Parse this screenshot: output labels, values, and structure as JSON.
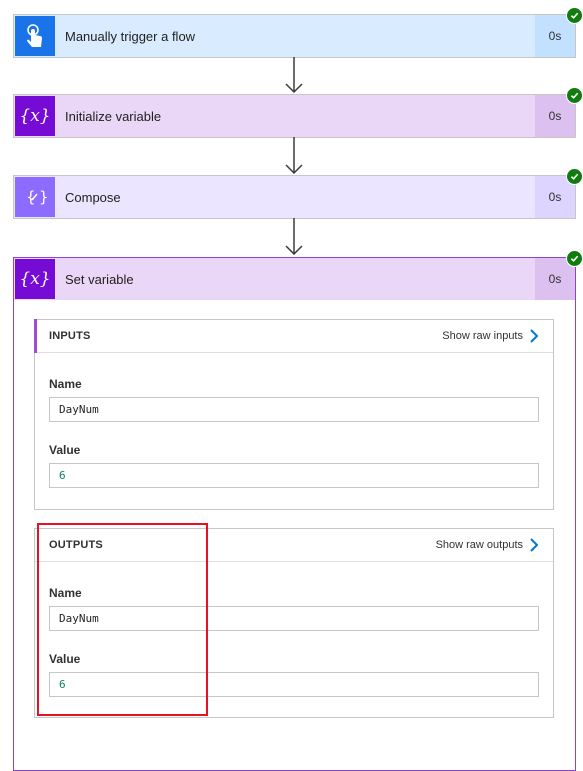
{
  "steps": [
    {
      "title": "Manually trigger a flow",
      "duration": "0s",
      "icon": "hand-touch-icon",
      "color": "#1a73e8",
      "bg": "#d9ecff",
      "dur_bg": "#c2e0ff"
    },
    {
      "title": "Initialize variable",
      "duration": "0s",
      "icon": "variable-icon",
      "color": "#770bd6",
      "bg": "#ead7f7",
      "dur_bg": "#dcc0f0"
    },
    {
      "title": "Compose",
      "duration": "0s",
      "icon": "compose-icon",
      "color": "#8c6cff",
      "bg": "#ebe5ff",
      "dur_bg": "#ddd4ff"
    },
    {
      "title": "Set variable",
      "duration": "0s",
      "icon": "variable-icon",
      "color": "#770bd6",
      "bg": "#ead7f7",
      "dur_bg": "#dcc0f0"
    }
  ],
  "inputs": {
    "heading": "INPUTS",
    "raw_link": "Show raw inputs",
    "name_label": "Name",
    "name_value": "DayNum",
    "value_label": "Value",
    "value_value": "6"
  },
  "outputs": {
    "heading": "OUTPUTS",
    "raw_link": "Show raw outputs",
    "name_label": "Name",
    "name_value": "DayNum",
    "value_label": "Value",
    "value_value": "6"
  },
  "colors": {
    "success": "#107c10",
    "link_chevron": "#0078d4",
    "highlight": "#e81123",
    "arrow": "#3b3a39"
  }
}
